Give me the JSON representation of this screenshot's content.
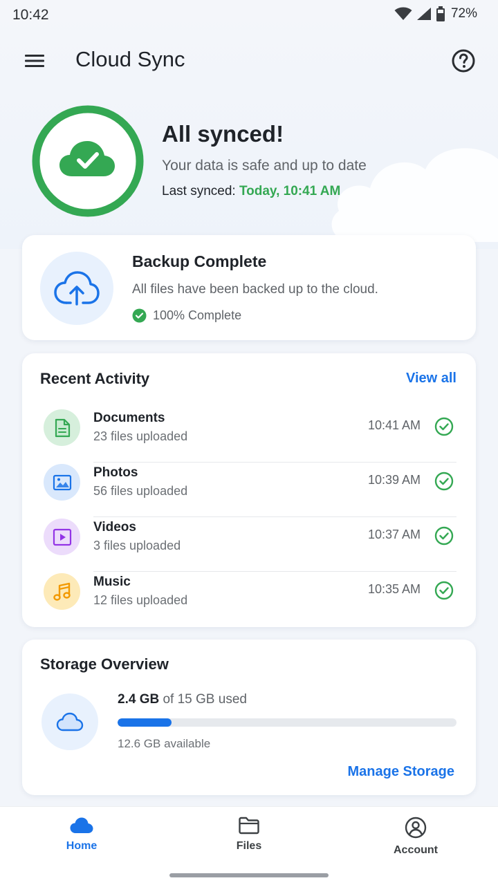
{
  "status_bar": {
    "time": "10:42",
    "battery": "72%"
  },
  "app_bar": {
    "title": "Cloud Sync"
  },
  "hero": {
    "title": "All synced!",
    "subtitle": "Your data is safe and up to date",
    "last_synced_label": "Last synced: ",
    "last_synced_value": "Today, 10:41 AM"
  },
  "backup": {
    "title": "Backup Complete",
    "description": "All files have been backed up to the cloud.",
    "status": "100% Complete"
  },
  "activity": {
    "title": "Recent Activity",
    "view_all": "View all",
    "items": [
      {
        "name": "Documents",
        "sub": "23 files uploaded",
        "time": "10:41 AM"
      },
      {
        "name": "Photos",
        "sub": "56 files uploaded",
        "time": "10:39 AM"
      },
      {
        "name": "Videos",
        "sub": "3 files uploaded",
        "time": "10:37 AM"
      },
      {
        "name": "Music",
        "sub": "12 files uploaded",
        "time": "10:35 AM"
      }
    ]
  },
  "storage": {
    "title": "Storage Overview",
    "used_value": "2.4 GB",
    "used_suffix": " of 15 GB used",
    "used_fraction": 0.16,
    "available": "12.6 GB available",
    "manage": "Manage Storage"
  },
  "bottom_nav": {
    "home": "Home",
    "files": "Files",
    "account": "Account"
  },
  "colors": {
    "accent": "#1a73e8",
    "success": "#34a853",
    "documents": "#34a853",
    "photos": "#1a73e8",
    "videos": "#9334e6",
    "music": "#f9ab00"
  }
}
